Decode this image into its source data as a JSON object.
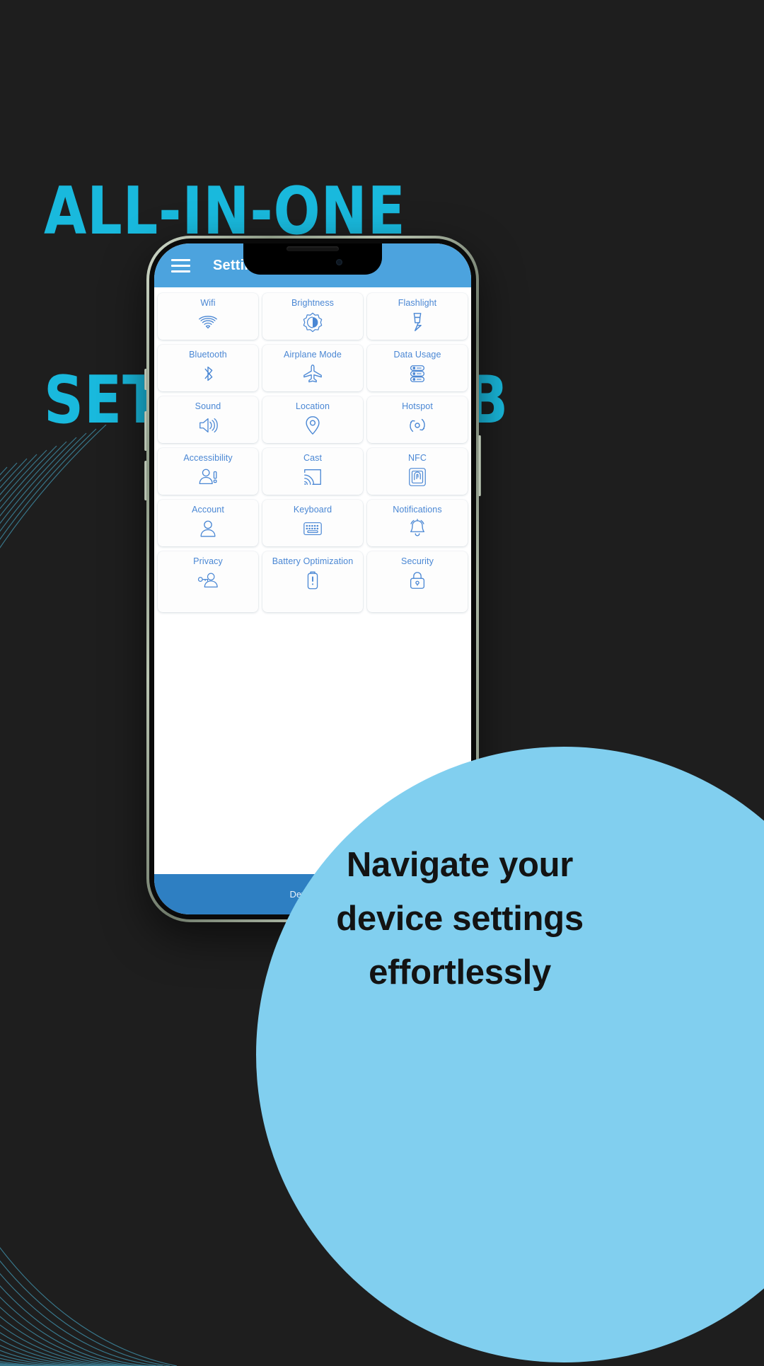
{
  "poster": {
    "background_color": "#1e1e1e",
    "accent_color": "#19b9dd",
    "circle_color": "#81cfef",
    "headline_line1": "ALL-IN-ONE",
    "headline_line2": "SETTINGS HUB",
    "tagline": "Navigate your device settings effortlessly"
  },
  "phone": {
    "app": {
      "header": {
        "title": "Settings",
        "menu_icon": "hamburger-menu-icon",
        "background_color": "#4ca3de"
      },
      "footer": {
        "label": "Device Info",
        "background_color": "#2e7fc2"
      },
      "tiles": [
        {
          "label": "Wifi",
          "icon": "wifi-icon"
        },
        {
          "label": "Brightness",
          "icon": "brightness-icon"
        },
        {
          "label": "Flashlight",
          "icon": "flashlight-icon"
        },
        {
          "label": "Bluetooth",
          "icon": "bluetooth-icon"
        },
        {
          "label": "Airplane Mode",
          "icon": "airplane-icon"
        },
        {
          "label": "Data Usage",
          "icon": "data-usage-icon"
        },
        {
          "label": "Sound",
          "icon": "sound-icon"
        },
        {
          "label": "Location",
          "icon": "location-pin-icon"
        },
        {
          "label": "Hotspot",
          "icon": "hotspot-icon"
        },
        {
          "label": "Accessibility",
          "icon": "accessibility-icon"
        },
        {
          "label": "Cast",
          "icon": "cast-icon"
        },
        {
          "label": "NFC",
          "icon": "nfc-icon"
        },
        {
          "label": "Account",
          "icon": "account-person-icon"
        },
        {
          "label": "Keyboard",
          "icon": "keyboard-icon"
        },
        {
          "label": "Notifications",
          "icon": "bell-icon"
        },
        {
          "label": "Privacy",
          "icon": "privacy-key-person-icon"
        },
        {
          "label": "Battery Optimization",
          "icon": "battery-icon"
        },
        {
          "label": "Security",
          "icon": "lock-icon"
        }
      ]
    }
  }
}
